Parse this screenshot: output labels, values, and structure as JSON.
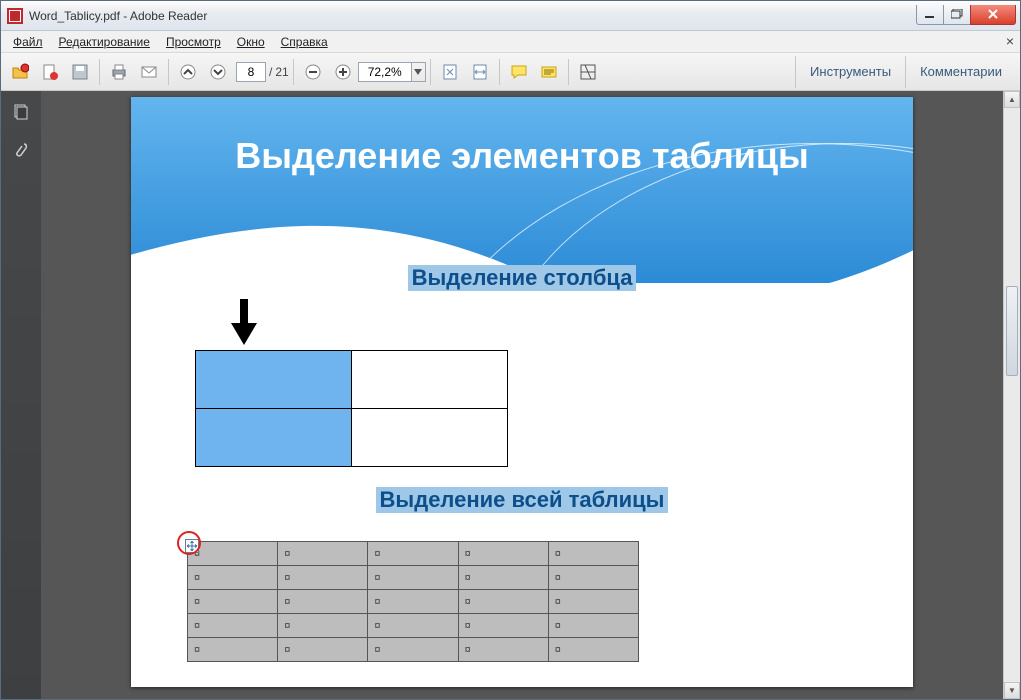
{
  "window": {
    "title": "Word_Tablicy.pdf - Adobe Reader"
  },
  "menu": {
    "file": "Файл",
    "edit": "Редактирование",
    "view": "Просмотр",
    "window": "Окно",
    "help": "Справка"
  },
  "toolbar": {
    "page_current": "8",
    "page_sep": "/",
    "page_total": "21",
    "zoom_value": "72,2%",
    "panel_tools": "Инструменты",
    "panel_comments": "Комментарии"
  },
  "document": {
    "heading": "Выделение элементов таблицы",
    "section_column": "Выделение столбца",
    "section_table": "Выделение всей таблицы",
    "cell_mark": "¤"
  }
}
